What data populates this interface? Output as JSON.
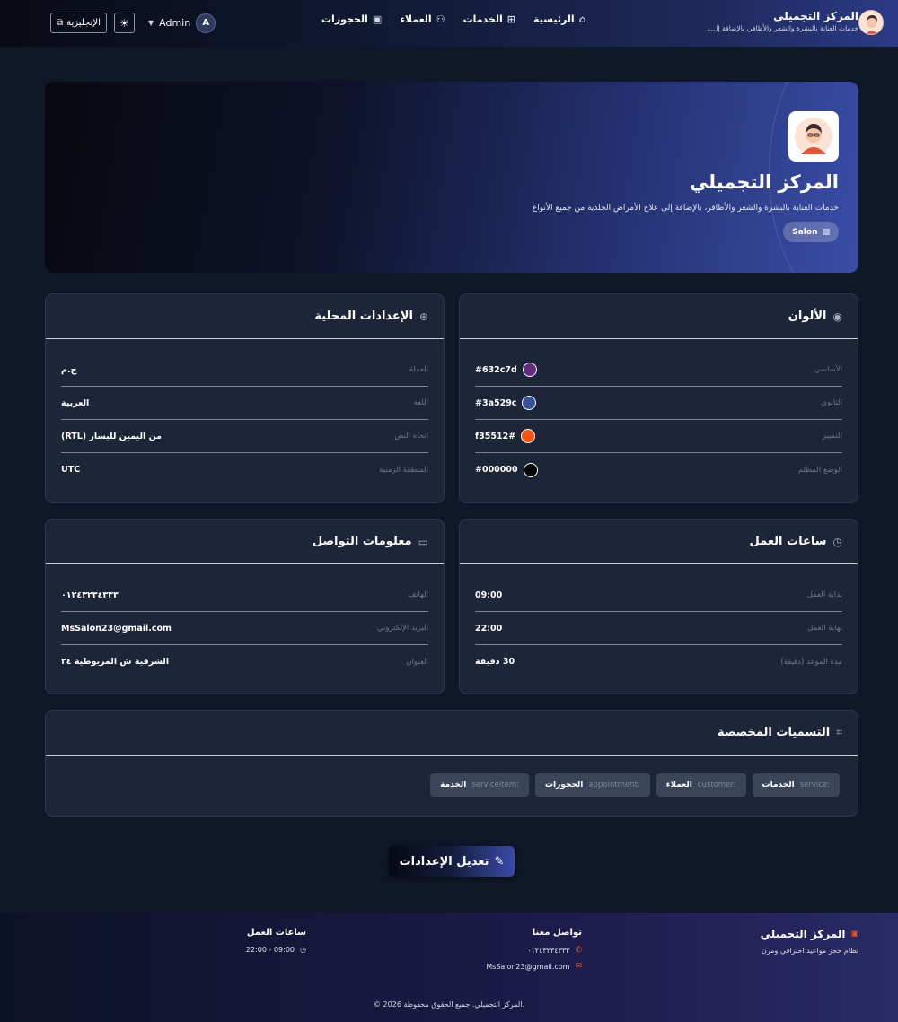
{
  "nav": {
    "lang_label": "الإنجليزية",
    "user_name": "Admin",
    "user_initial": "A",
    "links": [
      {
        "label": "الرئيسية"
      },
      {
        "label": "الخدمات"
      },
      {
        "label": "العملاء"
      },
      {
        "label": "الحجوزات"
      }
    ],
    "brand_title": "المركز التجميلي",
    "brand_subtitle": "خدمات العناية بالبشرة والشعر والأظافر، بالإضافة إل..."
  },
  "hero": {
    "title": "المركز التجميلي",
    "description": "خدمات العناية بالبشرة والشعر والأظافر، بالإضافة إلى علاج الأمراض الجلدية من جميع الأنواع",
    "badge": "Salon"
  },
  "colors_card": {
    "title": "الألوان",
    "rows": [
      {
        "label": "الأساسي",
        "value": "#632c7d",
        "color": "#632c7d"
      },
      {
        "label": "الثانوي",
        "value": "#3a529c",
        "color": "#3a529c"
      },
      {
        "label": "التمييز",
        "value": "#f35512",
        "color": "#f35512"
      },
      {
        "label": "الوضع المظلم",
        "value": "#000000",
        "color": "#000000"
      }
    ]
  },
  "locale_card": {
    "title": "الإعدادات المحلية",
    "rows": [
      {
        "label": "العملة",
        "value": "ج.م"
      },
      {
        "label": "اللغة",
        "value": "العربية"
      },
      {
        "label": "اتجاه النص",
        "value": "من اليمين لليسار (RTL)"
      },
      {
        "label": "المنطقة الزمنية",
        "value": "UTC"
      }
    ]
  },
  "hours_card": {
    "title": "ساعات العمل",
    "rows": [
      {
        "label": "بداية العمل",
        "value": "09:00"
      },
      {
        "label": "نهاية العمل",
        "value": "22:00"
      },
      {
        "label": "مدة الموعد (دقيقة)",
        "value": "30 دقيقة"
      }
    ]
  },
  "contact_card": {
    "title": "معلومات التواصل",
    "rows": [
      {
        "label": "الهاتف",
        "value": "٠١٢٤٣٢٣٤٣٣٣"
      },
      {
        "label": "البريد الإلكتروني",
        "value": "MsSalon23@gmail.com"
      },
      {
        "label": "العنوان",
        "value": "الشرقية ش المريوطية ٢٤"
      }
    ]
  },
  "labels_card": {
    "title": "التسميات المخصصة",
    "tags": [
      {
        "key": "service:",
        "value": "الخدمات"
      },
      {
        "key": "customer:",
        "value": "العملاء"
      },
      {
        "key": "appointment:",
        "value": "الحجوزات"
      },
      {
        "key": "serviceItem:",
        "value": "الخدمة"
      }
    ]
  },
  "edit_button": "تعديل الإعدادات",
  "footer": {
    "brand_title": "المركز التجميلي",
    "brand_text": "نظام حجز مواعيد احترافي ومرن",
    "contact_title": "تواصل معنا",
    "phone": "٠١٢٤٣٢٣٤٣٣٣",
    "email": "MsSalon23@gmail.com",
    "hours_title": "ساعات العمل",
    "hours": "09:00 - 22:00",
    "copyright": "© 2026 المركز التجميلي. جميع الحقوق محفوظة."
  }
}
